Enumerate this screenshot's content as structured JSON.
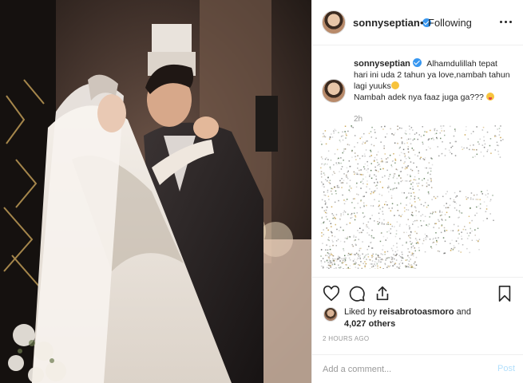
{
  "post": {
    "username": "sonnyseptian",
    "verified": true,
    "separator": "•",
    "follow_status": "Following",
    "caption": {
      "text_line1": "Alhamdulillah tepat hari ini uda 2 tahun ya love,nambah tahun lagi yuuks",
      "text_line2": "Nambah adek nya faaz juga ga???",
      "time": "2h"
    },
    "likes": {
      "liked_by_prefix": "Liked by ",
      "liked_by_user": "reisabrotoasmoro",
      "and": " and",
      "others": "4,027 others"
    },
    "timestamp": "2 HOURS AGO",
    "comment_input": {
      "placeholder": "Add a comment...",
      "post_label": "Post"
    }
  },
  "icons": {
    "more": "more-options-icon",
    "like": "heart-icon",
    "comment": "comment-bubble-icon",
    "share": "share-icon",
    "save": "bookmark-icon",
    "verified": "verified-badge-icon"
  },
  "colors": {
    "accent": "#3897f0",
    "border": "#efefef",
    "muted_text": "#999999",
    "post_button_disabled": "#b2dffc"
  }
}
